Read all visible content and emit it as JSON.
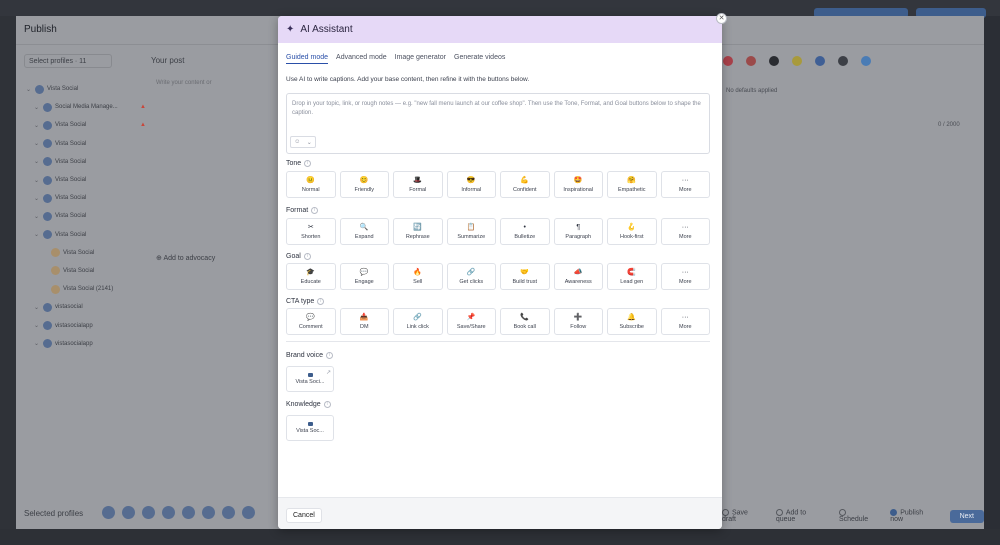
{
  "background": {
    "publish_title": "Publish",
    "select_profiles": "Select profiles · 11",
    "your_post": "Your post",
    "write_content": "Write your content or",
    "profiles": [
      {
        "label": "Vista Social",
        "level": 0
      },
      {
        "label": "Social Media Manage...",
        "level": 1,
        "warn": true
      },
      {
        "label": "Vista Social",
        "level": 1,
        "warn": true
      },
      {
        "label": "Vista Social",
        "level": 1
      },
      {
        "label": "Vista Social",
        "level": 1
      },
      {
        "label": "Vista Social",
        "level": 1
      },
      {
        "label": "Vista Social",
        "level": 1
      },
      {
        "label": "Vista Social",
        "level": 1
      },
      {
        "label": "Vista Social",
        "level": 1
      },
      {
        "label": "Vista Social",
        "level": 2
      },
      {
        "label": "Vista Social",
        "level": 2
      },
      {
        "label": "Vista Social (2141)",
        "level": 2
      },
      {
        "label": "vistasocial",
        "level": 1
      },
      {
        "label": "vistasocialapp",
        "level": 1
      },
      {
        "label": "vistasocialapp",
        "level": 1
      }
    ],
    "add_to_advocacy": "Add to advocacy",
    "selected_profiles": "Selected profiles",
    "no_defaults": "No defaults applied",
    "counter": "0 / 2000",
    "bottom_actions": {
      "save_draft": "Save draft",
      "add_to_queue": "Add to queue",
      "schedule": "Schedule",
      "publish_now": "Publish now",
      "next": "Next"
    }
  },
  "modal": {
    "title": "AI Assistant",
    "tabs": [
      "Guided mode",
      "Advanced mode",
      "Image generator",
      "Generate videos"
    ],
    "intro": "Use AI to write captions. Add your base content, then refine it with the buttons below.",
    "prompt_placeholder": "Drop in your topic, link, or rough notes — e.g. \"new fall menu launch at our coffee shop\". Then use the Tone, Format, and Goal buttons below to shape the caption.",
    "sections": {
      "tone": {
        "label": "Tone",
        "options": [
          {
            "label": "Normal",
            "icon": "😐"
          },
          {
            "label": "Friendly",
            "icon": "😊"
          },
          {
            "label": "Formal",
            "icon": "🎩"
          },
          {
            "label": "Informal",
            "icon": "😎"
          },
          {
            "label": "Confident",
            "icon": "💪"
          },
          {
            "label": "Inspirational",
            "icon": "🤩"
          },
          {
            "label": "Empathetic",
            "icon": "🤗"
          },
          {
            "label": "More",
            "icon": "···"
          }
        ]
      },
      "format": {
        "label": "Format",
        "options": [
          {
            "label": "Shorten",
            "icon": "✂"
          },
          {
            "label": "Expand",
            "icon": "🔍"
          },
          {
            "label": "Rephrase",
            "icon": "🔄"
          },
          {
            "label": "Summarize",
            "icon": "📋"
          },
          {
            "label": "Bulletize",
            "icon": "•"
          },
          {
            "label": "Paragraph",
            "icon": "¶"
          },
          {
            "label": "Hook-first",
            "icon": "🪝"
          },
          {
            "label": "More",
            "icon": "···"
          }
        ]
      },
      "goal": {
        "label": "Goal",
        "options": [
          {
            "label": "Educate",
            "icon": "🎓"
          },
          {
            "label": "Engage",
            "icon": "💬"
          },
          {
            "label": "Sell",
            "icon": "🔥"
          },
          {
            "label": "Get clicks",
            "icon": "🔗"
          },
          {
            "label": "Build trust",
            "icon": "🤝"
          },
          {
            "label": "Awareness",
            "icon": "📣"
          },
          {
            "label": "Lead gen",
            "icon": "🧲"
          },
          {
            "label": "More",
            "icon": "···"
          }
        ]
      },
      "cta": {
        "label": "CTA type",
        "options": [
          {
            "label": "Comment",
            "icon": "💬"
          },
          {
            "label": "DM",
            "icon": "📥"
          },
          {
            "label": "Link click",
            "icon": "🔗"
          },
          {
            "label": "Save/Share",
            "icon": "📌"
          },
          {
            "label": "Book call",
            "icon": "📞"
          },
          {
            "label": "Follow",
            "icon": "➕"
          },
          {
            "label": "Subscribe",
            "icon": "🔔"
          },
          {
            "label": "More",
            "icon": "···"
          }
        ]
      }
    },
    "brand_voice": {
      "label": "Brand voice",
      "card": "Vista Soci..."
    },
    "knowledge": {
      "label": "Knowledge",
      "card": "Vista Soc..."
    },
    "cancel": "Cancel"
  },
  "colors": {
    "header_bg": "#e6d9f7",
    "tab_active": "#2a4fa8",
    "overlay": "#9a9ca1"
  }
}
